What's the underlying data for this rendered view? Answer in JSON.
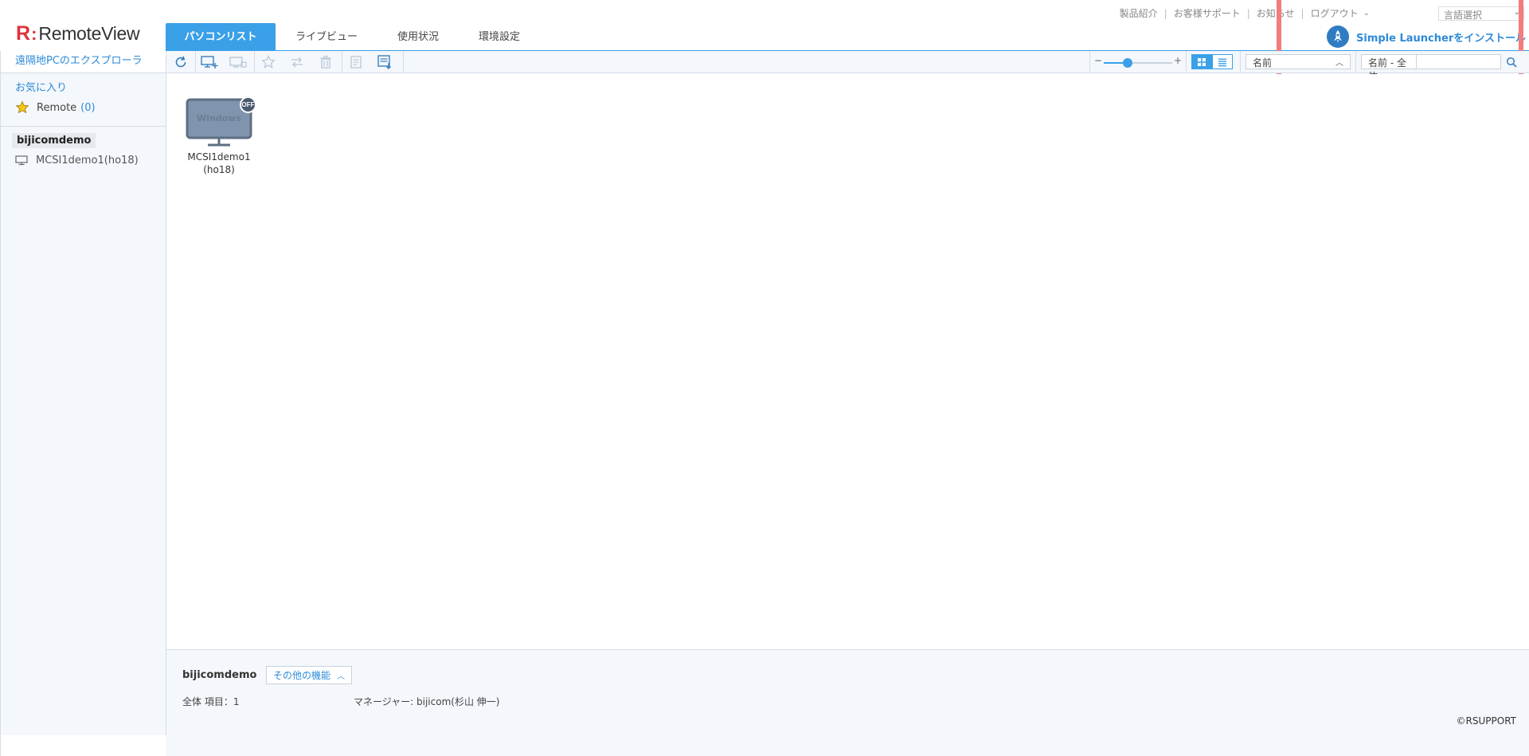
{
  "app": {
    "logo_mark": "R",
    "logo_colon": ":",
    "logo_text": "RemoteView"
  },
  "tabs": [
    {
      "label": "パソコンリスト",
      "active": true
    },
    {
      "label": "ライブビュー",
      "active": false
    },
    {
      "label": "使用状況",
      "active": false
    },
    {
      "label": "環境設定",
      "active": false
    }
  ],
  "top_links": {
    "products": "製品紹介",
    "support": "お客様サポート",
    "news": "お知らせ",
    "logout": "ログアウト",
    "separator": "|",
    "language_placeholder": "言語選択"
  },
  "launcher": {
    "label": "Simple Launcherをインストール"
  },
  "sidebar": {
    "explorer_title": "遠隔地PCのエクスプローラ",
    "favorites_title": "お気に入り",
    "favorite_item": {
      "label": "Remote",
      "count": "(0)"
    },
    "group": "bijicomdemo",
    "pc_item": "MCSI1demo1(ho18)"
  },
  "toolbar": {
    "zoom_minus": "−",
    "zoom_plus": "+",
    "zoom_level": 0.35,
    "sort_label": "名前",
    "search_scope": "名前 - 全体",
    "search_value": ""
  },
  "main": {
    "pc_tile": {
      "os_label": "Windows",
      "status": "OFF",
      "name_line1": "MCSI1demo1",
      "name_line2": "(ho18)"
    }
  },
  "footer": {
    "group_name": "bijicomdemo",
    "more_features": "その他の機能",
    "total_items": "全体 項目：1",
    "manager": "マネージャー: bijicom(杉山 伸一)",
    "copyright": "©RSUPPORT"
  },
  "colors": {
    "accent": "#3aa0e8",
    "logo_red": "#e0313b",
    "highlight": "#f27d7d",
    "link_blue": "#2d8ad8"
  },
  "icons": [
    "refresh-icon",
    "add-pc-icon",
    "remote-pc-icon",
    "star-icon",
    "move-icon",
    "delete-icon",
    "memo-icon",
    "export-icon",
    "grid-view-icon",
    "list-view-icon",
    "search-icon",
    "rocket-icon",
    "monitor-icon"
  ]
}
